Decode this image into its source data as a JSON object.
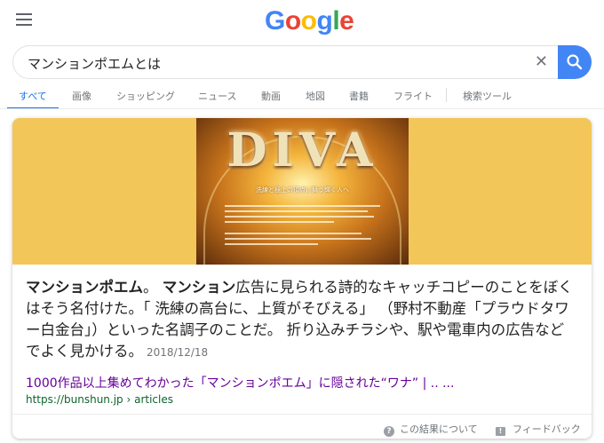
{
  "header": {
    "logo_letters": [
      {
        "char": "G",
        "color": "#4285f4"
      },
      {
        "char": "o",
        "color": "#ea4335"
      },
      {
        "char": "o",
        "color": "#fbbc05"
      },
      {
        "char": "g",
        "color": "#4285f4"
      },
      {
        "char": "l",
        "color": "#34a853"
      },
      {
        "char": "e",
        "color": "#ea4335"
      }
    ]
  },
  "search": {
    "query": "マンションポエムとは",
    "clear_glyph": "✕"
  },
  "tabs": [
    {
      "label": "すべて",
      "active": true
    },
    {
      "label": "画像"
    },
    {
      "label": "ショッピング"
    },
    {
      "label": "ニュース"
    },
    {
      "label": "動画"
    },
    {
      "label": "地図"
    },
    {
      "label": "書籍"
    },
    {
      "label": "フライト"
    },
    {
      "label": "検索ツール"
    }
  ],
  "featured_image": {
    "title": "DIVA",
    "tagline": "洗練と極上の頂点に舞う輝く人へ"
  },
  "snippet": {
    "bold_1": "マンションポエム",
    "text_1": "。 ",
    "bold_2": "マンション",
    "text_2": "広告に見られる詩的なキャッチコピーのことをぼくはそう名付けた。「 洗練の高台に、上質がそびえる」 （野村不動産「プラウドタワー白金台」）といった名調子のことだ。 折り込みチラシや、駅や電車内の広告などでよく見かける。",
    "date": "2018/12/18"
  },
  "result": {
    "title": "1000作品以上集めてわかった「マンションポエム」に隠された“ワナ” | .. ...",
    "url": "https://bunshun.jp › articles"
  },
  "footer": {
    "about_label": "この結果について",
    "feedback_label": "フィードバック"
  },
  "colors": {
    "accent": "#1a73e8",
    "search_button": "#4285f4",
    "hero_background": "#f2c659",
    "visited_link": "#660099",
    "url_green": "#0d652d"
  }
}
